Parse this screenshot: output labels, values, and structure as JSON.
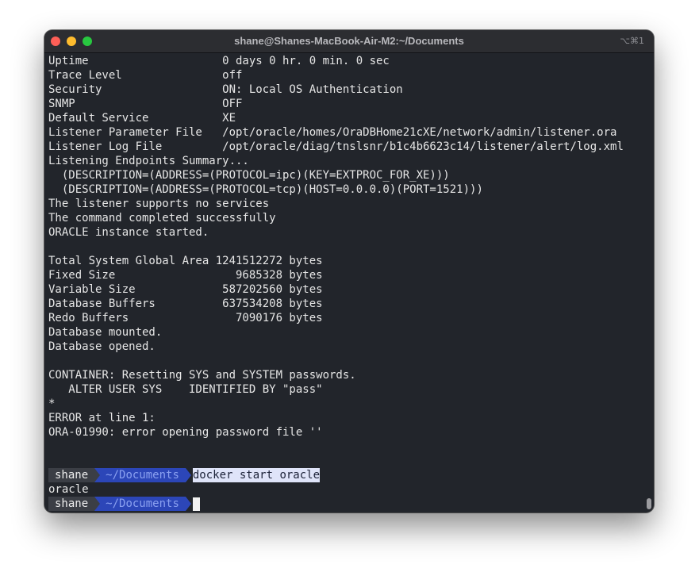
{
  "window": {
    "title": "shane@Shanes-MacBook-Air-M2:~/Documents",
    "shortcut": "⌥⌘1"
  },
  "terminal": {
    "lines": [
      "Uptime                    0 days 0 hr. 0 min. 0 sec",
      "Trace Level               off",
      "Security                  ON: Local OS Authentication",
      "SNMP                      OFF",
      "Default Service           XE",
      "Listener Parameter File   /opt/oracle/homes/OraDBHome21cXE/network/admin/listener.ora",
      "Listener Log File         /opt/oracle/diag/tnslsnr/b1c4b6623c14/listener/alert/log.xml",
      "Listening Endpoints Summary...",
      "  (DESCRIPTION=(ADDRESS=(PROTOCOL=ipc)(KEY=EXTPROC_FOR_XE)))",
      "  (DESCRIPTION=(ADDRESS=(PROTOCOL=tcp)(HOST=0.0.0.0)(PORT=1521)))",
      "The listener supports no services",
      "The command completed successfully",
      "ORACLE instance started.",
      "",
      "Total System Global Area 1241512272 bytes",
      "Fixed Size                  9685328 bytes",
      "Variable Size             587202560 bytes",
      "Database Buffers          637534208 bytes",
      "Redo Buffers                7090176 bytes",
      "Database mounted.",
      "Database opened.",
      "",
      "CONTAINER: Resetting SYS and SYSTEM passwords.",
      "   ALTER USER SYS    IDENTIFIED BY \"pass\"",
      "*",
      "ERROR at line 1:",
      "ORA-01990: error opening password file ''",
      "",
      ""
    ],
    "prompt1": {
      "user": "shane",
      "dir": "~/Documents",
      "command": "docker start oracle"
    },
    "output_after_prompt1": "oracle",
    "prompt2": {
      "user": "shane",
      "dir": "~/Documents"
    }
  },
  "colors": {
    "background": "#22252b",
    "prompt_user_bg": "#3b3e45",
    "prompt_dir_bg": "#2c46b8",
    "prompt_dir_fg": "#8aa0f0",
    "command_highlight_bg": "#dfe4f9",
    "close": "#fe5f57",
    "minimize": "#febc2e",
    "maximize": "#28c840"
  }
}
